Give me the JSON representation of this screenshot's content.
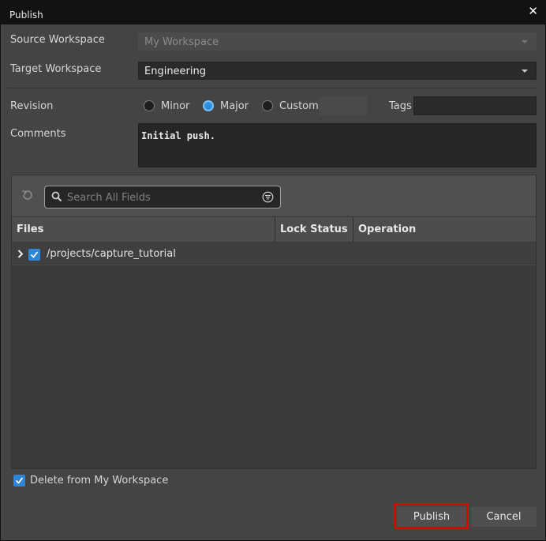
{
  "window": {
    "title": "Publish"
  },
  "form": {
    "source_label": "Source Workspace",
    "source_value": "My Workspace",
    "target_label": "Target Workspace",
    "target_value": "Engineering",
    "revision_label": "Revision",
    "revision_options": [
      "Minor",
      "Major",
      "Custom"
    ],
    "revision_selected": "Major",
    "custom_value": "",
    "tags_label": "Tags",
    "tags_value": "",
    "comments_label": "Comments",
    "comments_value": "Initial push."
  },
  "files_panel": {
    "search_placeholder": "Search All Fields",
    "columns": [
      "Files",
      "Lock Status",
      "Operation"
    ],
    "rows": [
      {
        "path": "/projects/capture_tutorial",
        "checked": true,
        "lock_status": "",
        "operation": ""
      }
    ]
  },
  "footer": {
    "delete_label": "Delete from My Workspace",
    "delete_checked": true,
    "publish_label": "Publish",
    "cancel_label": "Cancel"
  },
  "colors": {
    "accent": "#2e86d6",
    "highlight": "#e30000",
    "titlebar": "#121212",
    "background": "#444444"
  }
}
